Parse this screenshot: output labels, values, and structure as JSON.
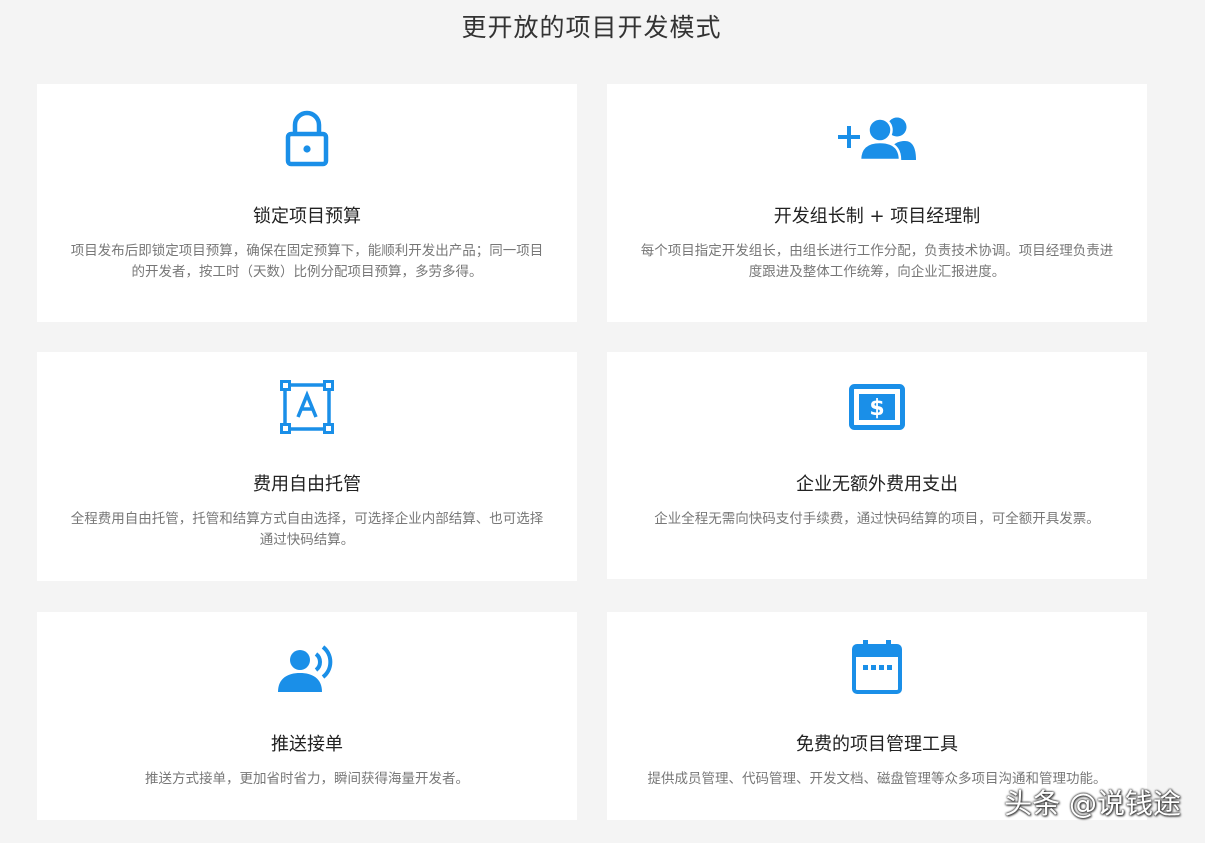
{
  "page": {
    "title": "更开放的项目开发模式"
  },
  "colors": {
    "accent": "#1a8fe8",
    "background": "#f4f4f4",
    "card": "#ffffff"
  },
  "cards": [
    {
      "icon": "lock-icon",
      "title": "锁定项目预算",
      "desc": "项目发布后即锁定项目预算，确保在固定预算下，能顺利开发出产品；同一项目的开发者，按工时（天数）比例分配项目预算，多劳多得。"
    },
    {
      "icon": "add-users-icon",
      "title": "开发组长制 + 项目经理制",
      "desc": "每个项目指定开发组长，由组长进行工作分配，负责技术协调。项目经理负责进度跟进及整体工作统筹，向企业汇报进度。"
    },
    {
      "icon": "text-select-icon",
      "title": "费用自由托管",
      "desc": "全程费用自由托管，托管和结算方式自由选择，可选择企业内部结算、也可选择通过快码结算。"
    },
    {
      "icon": "dollar-bill-icon",
      "title": "企业无额外费用支出",
      "desc": "企业全程无需向快码支付手续费，通过快码结算的项目，可全额开具发票。"
    },
    {
      "icon": "voice-user-icon",
      "title": "推送接单",
      "desc": "推送方式接单，更加省时省力，瞬间获得海量开发者。"
    },
    {
      "icon": "calendar-icon",
      "title": "免费的项目管理工具",
      "desc": "提供成员管理、代码管理、开发文档、磁盘管理等众多项目沟通和管理功能。"
    }
  ],
  "watermark": "头条 @说钱途"
}
